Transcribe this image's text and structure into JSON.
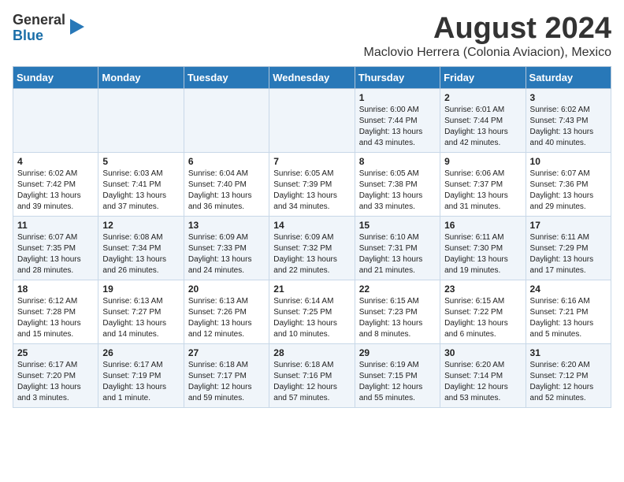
{
  "logo": {
    "general": "General",
    "blue": "Blue"
  },
  "title": "August 2024",
  "subtitle": "Maclovio Herrera (Colonia Aviacion), Mexico",
  "days_of_week": [
    "Sunday",
    "Monday",
    "Tuesday",
    "Wednesday",
    "Thursday",
    "Friday",
    "Saturday"
  ],
  "weeks": [
    [
      {
        "day": "",
        "content": ""
      },
      {
        "day": "",
        "content": ""
      },
      {
        "day": "",
        "content": ""
      },
      {
        "day": "",
        "content": ""
      },
      {
        "day": "1",
        "content": "Sunrise: 6:00 AM\nSunset: 7:44 PM\nDaylight: 13 hours\nand 43 minutes."
      },
      {
        "day": "2",
        "content": "Sunrise: 6:01 AM\nSunset: 7:44 PM\nDaylight: 13 hours\nand 42 minutes."
      },
      {
        "day": "3",
        "content": "Sunrise: 6:02 AM\nSunset: 7:43 PM\nDaylight: 13 hours\nand 40 minutes."
      }
    ],
    [
      {
        "day": "4",
        "content": "Sunrise: 6:02 AM\nSunset: 7:42 PM\nDaylight: 13 hours\nand 39 minutes."
      },
      {
        "day": "5",
        "content": "Sunrise: 6:03 AM\nSunset: 7:41 PM\nDaylight: 13 hours\nand 37 minutes."
      },
      {
        "day": "6",
        "content": "Sunrise: 6:04 AM\nSunset: 7:40 PM\nDaylight: 13 hours\nand 36 minutes."
      },
      {
        "day": "7",
        "content": "Sunrise: 6:05 AM\nSunset: 7:39 PM\nDaylight: 13 hours\nand 34 minutes."
      },
      {
        "day": "8",
        "content": "Sunrise: 6:05 AM\nSunset: 7:38 PM\nDaylight: 13 hours\nand 33 minutes."
      },
      {
        "day": "9",
        "content": "Sunrise: 6:06 AM\nSunset: 7:37 PM\nDaylight: 13 hours\nand 31 minutes."
      },
      {
        "day": "10",
        "content": "Sunrise: 6:07 AM\nSunset: 7:36 PM\nDaylight: 13 hours\nand 29 minutes."
      }
    ],
    [
      {
        "day": "11",
        "content": "Sunrise: 6:07 AM\nSunset: 7:35 PM\nDaylight: 13 hours\nand 28 minutes."
      },
      {
        "day": "12",
        "content": "Sunrise: 6:08 AM\nSunset: 7:34 PM\nDaylight: 13 hours\nand 26 minutes."
      },
      {
        "day": "13",
        "content": "Sunrise: 6:09 AM\nSunset: 7:33 PM\nDaylight: 13 hours\nand 24 minutes."
      },
      {
        "day": "14",
        "content": "Sunrise: 6:09 AM\nSunset: 7:32 PM\nDaylight: 13 hours\nand 22 minutes."
      },
      {
        "day": "15",
        "content": "Sunrise: 6:10 AM\nSunset: 7:31 PM\nDaylight: 13 hours\nand 21 minutes."
      },
      {
        "day": "16",
        "content": "Sunrise: 6:11 AM\nSunset: 7:30 PM\nDaylight: 13 hours\nand 19 minutes."
      },
      {
        "day": "17",
        "content": "Sunrise: 6:11 AM\nSunset: 7:29 PM\nDaylight: 13 hours\nand 17 minutes."
      }
    ],
    [
      {
        "day": "18",
        "content": "Sunrise: 6:12 AM\nSunset: 7:28 PM\nDaylight: 13 hours\nand 15 minutes."
      },
      {
        "day": "19",
        "content": "Sunrise: 6:13 AM\nSunset: 7:27 PM\nDaylight: 13 hours\nand 14 minutes."
      },
      {
        "day": "20",
        "content": "Sunrise: 6:13 AM\nSunset: 7:26 PM\nDaylight: 13 hours\nand 12 minutes."
      },
      {
        "day": "21",
        "content": "Sunrise: 6:14 AM\nSunset: 7:25 PM\nDaylight: 13 hours\nand 10 minutes."
      },
      {
        "day": "22",
        "content": "Sunrise: 6:15 AM\nSunset: 7:23 PM\nDaylight: 13 hours\nand 8 minutes."
      },
      {
        "day": "23",
        "content": "Sunrise: 6:15 AM\nSunset: 7:22 PM\nDaylight: 13 hours\nand 6 minutes."
      },
      {
        "day": "24",
        "content": "Sunrise: 6:16 AM\nSunset: 7:21 PM\nDaylight: 13 hours\nand 5 minutes."
      }
    ],
    [
      {
        "day": "25",
        "content": "Sunrise: 6:17 AM\nSunset: 7:20 PM\nDaylight: 13 hours\nand 3 minutes."
      },
      {
        "day": "26",
        "content": "Sunrise: 6:17 AM\nSunset: 7:19 PM\nDaylight: 13 hours\nand 1 minute."
      },
      {
        "day": "27",
        "content": "Sunrise: 6:18 AM\nSunset: 7:17 PM\nDaylight: 12 hours\nand 59 minutes."
      },
      {
        "day": "28",
        "content": "Sunrise: 6:18 AM\nSunset: 7:16 PM\nDaylight: 12 hours\nand 57 minutes."
      },
      {
        "day": "29",
        "content": "Sunrise: 6:19 AM\nSunset: 7:15 PM\nDaylight: 12 hours\nand 55 minutes."
      },
      {
        "day": "30",
        "content": "Sunrise: 6:20 AM\nSunset: 7:14 PM\nDaylight: 12 hours\nand 53 minutes."
      },
      {
        "day": "31",
        "content": "Sunrise: 6:20 AM\nSunset: 7:12 PM\nDaylight: 12 hours\nand 52 minutes."
      }
    ]
  ]
}
